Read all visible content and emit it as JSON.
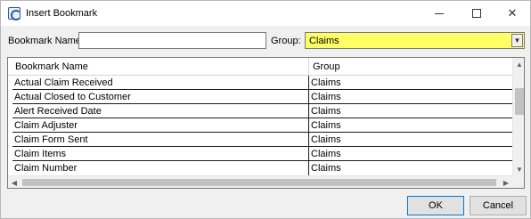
{
  "window": {
    "title": "Insert Bookmark",
    "icon": "bookmark-app-icon",
    "controls": {
      "minimize": "minimize-icon",
      "maximize": "maximize-icon",
      "close": "✕"
    }
  },
  "form": {
    "bookmark_name_label": "Bookmark Name:",
    "bookmark_name_value": "",
    "group_label": "Group:",
    "group_value": "Claims",
    "group_highlight_color": "#ffff66",
    "dropdown_arrow": "▼"
  },
  "grid": {
    "columns": [
      "Bookmark Name",
      "Group"
    ],
    "rows": [
      {
        "name": "Actual Claim Received",
        "group": "Claims"
      },
      {
        "name": "Actual Closed to Customer",
        "group": "Claims"
      },
      {
        "name": "Alert Received Date",
        "group": "Claims"
      },
      {
        "name": "Claim Adjuster",
        "group": "Claims"
      },
      {
        "name": "Claim Form Sent",
        "group": "Claims"
      },
      {
        "name": "Claim Items",
        "group": "Claims"
      },
      {
        "name": "Claim Number",
        "group": "Claims"
      }
    ],
    "scroll_up": "▲",
    "scroll_down": "▼",
    "scroll_left": "◀",
    "scroll_right": "▶"
  },
  "buttons": {
    "ok_label": "OK",
    "cancel_label": "Cancel"
  }
}
